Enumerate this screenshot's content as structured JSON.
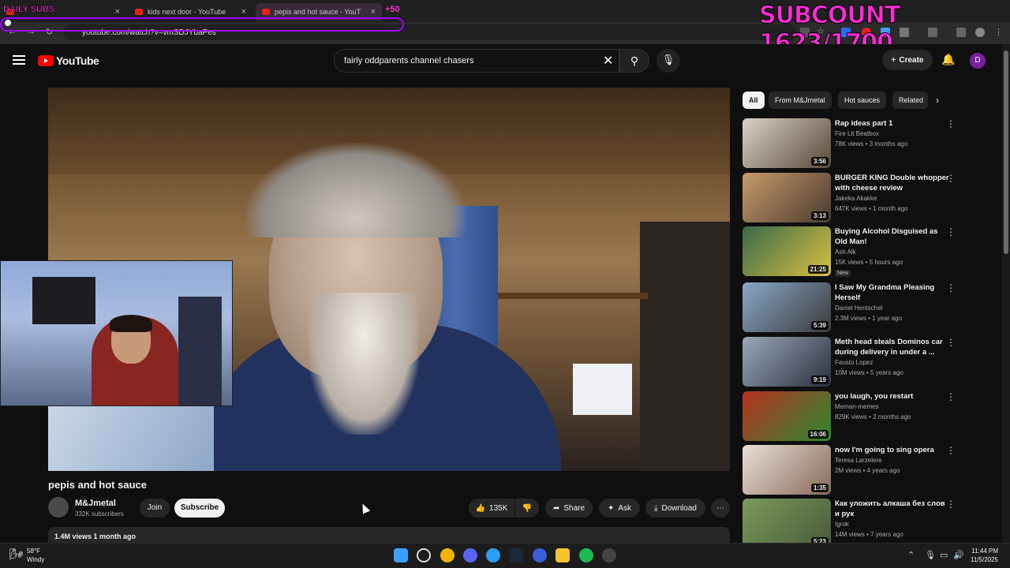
{
  "overlay": {
    "subcount": "SUBCOUNT 1623/1700",
    "daily_subs": "DAILY SUBS:",
    "plus": "+50"
  },
  "browser": {
    "tabs": [
      {
        "label": ""
      },
      {
        "label": "kids next door - YouTube"
      },
      {
        "label": "pepis and hot sauce - YouT"
      }
    ],
    "url": "youtube.com/watch?v=vmSDJYbaPes"
  },
  "header": {
    "logo_text": "YouTube",
    "search_value": "fairly oddparents channel chasers",
    "create_label": "Create",
    "avatar_letter": "D"
  },
  "video": {
    "title": "pepis and hot sauce",
    "channel": "M&Jmetal",
    "subscribers": "332K subscribers",
    "join_label": "Join",
    "subscribe_label": "Subscribe",
    "likes": "135K",
    "share_label": "Share",
    "ask_label": "Ask",
    "download_label": "Download",
    "views_date": "1.4M views  1 month ago"
  },
  "chips": [
    "All",
    "From M&Jmetal",
    "Hot sauces",
    "Related"
  ],
  "recommendations": [
    {
      "title": "Rap ideas part 1",
      "channel": "Fire Lit Beatbox",
      "meta": "78K views • 3 months ago",
      "duration": "3:56",
      "colors": [
        "#d8d2c8",
        "#5a4a3a"
      ]
    },
    {
      "title": "BURGER KING Double whopper with cheese review",
      "channel": "Jakeka Akakke",
      "meta": "647K views • 1 month ago",
      "duration": "3:13",
      "colors": [
        "#c89a6a",
        "#4a3a30"
      ]
    },
    {
      "title": "Buying Alcohol Disguised as Old Man!",
      "channel": "Ash Alk",
      "meta": "15K views • 5 hours ago",
      "duration": "21:25",
      "badge": "New",
      "colors": [
        "#3a6a4a",
        "#d8c040"
      ]
    },
    {
      "title": "I Saw My Grandma Pleasing Herself",
      "channel": "Daniel Hentschel",
      "meta": "2.3M views • 1 year ago",
      "duration": "5:39",
      "colors": [
        "#8aa8c8",
        "#3a3a3a"
      ]
    },
    {
      "title": "Meth head steals Dominos car during delivery in under a ...",
      "channel": "Fausto Lopez",
      "meta": "10M views • 5 years ago",
      "duration": "9:19",
      "colors": [
        "#9aa8b8",
        "#2a3040"
      ]
    },
    {
      "title": "you laugh, you restart",
      "channel": "Meman-memes",
      "meta": "829K views • 2 months ago",
      "duration": "16:06",
      "colors": [
        "#b83020",
        "#2a8a30"
      ]
    },
    {
      "title": "now I'm going to sing opera",
      "channel": "Teresa Larzelere",
      "meta": "2M views • 4 years ago",
      "duration": "1:35",
      "colors": [
        "#e8e0d8",
        "#8a6a5a"
      ]
    },
    {
      "title": "Как уложить алкаша без слов и рук",
      "channel": "Igrok",
      "meta": "14M views • 7 years ago",
      "duration": "5:23",
      "colors": [
        "#7a9a5a",
        "#4a5a3a"
      ]
    }
  ],
  "taskbar": {
    "temp": "58°F",
    "weather": "Windy",
    "time": "11:44 PM",
    "date": "11/5/2025"
  }
}
